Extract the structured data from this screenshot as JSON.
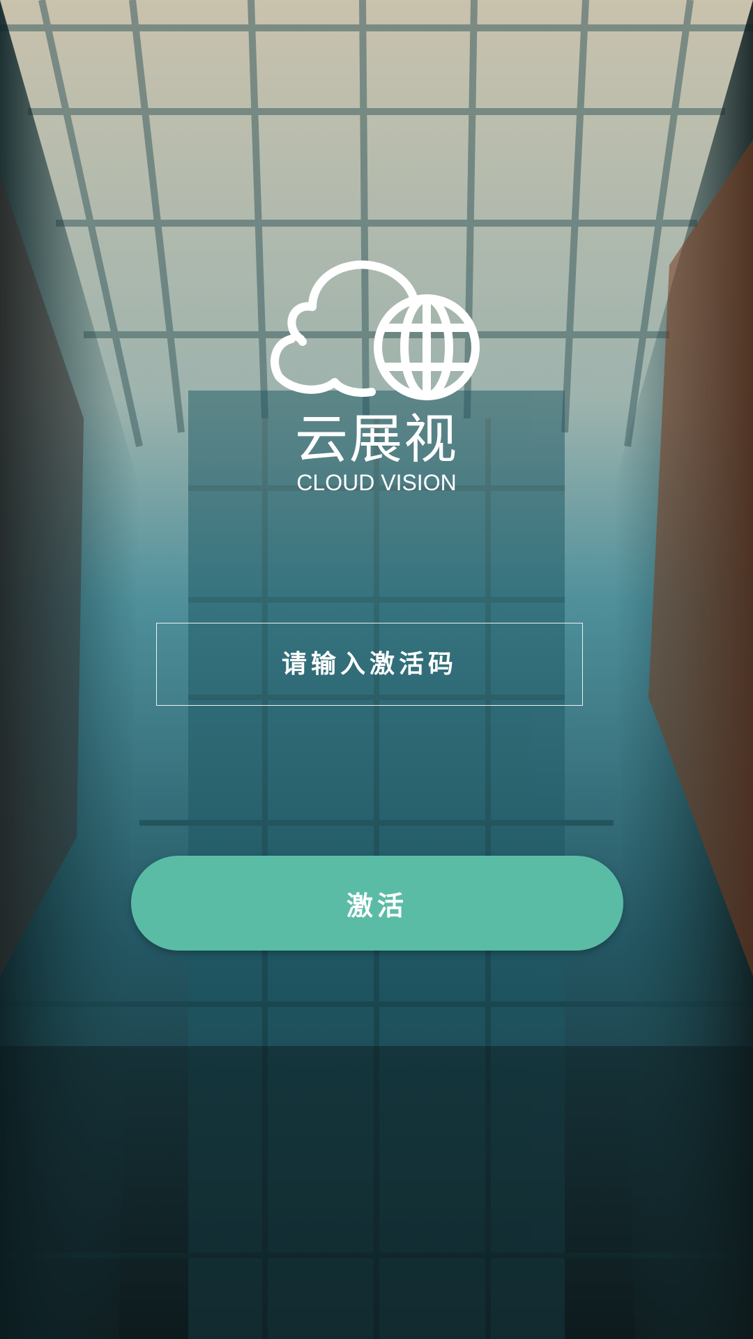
{
  "brand": {
    "name_cn": "云展视",
    "name_en": "CLOUD VISION",
    "logo_icon": "cloud-globe-icon"
  },
  "activation": {
    "code_placeholder": "请输入激活码",
    "code_value": "",
    "activate_label": "激活"
  },
  "colors": {
    "accent": "#5bbca6",
    "text": "#ffffff"
  }
}
